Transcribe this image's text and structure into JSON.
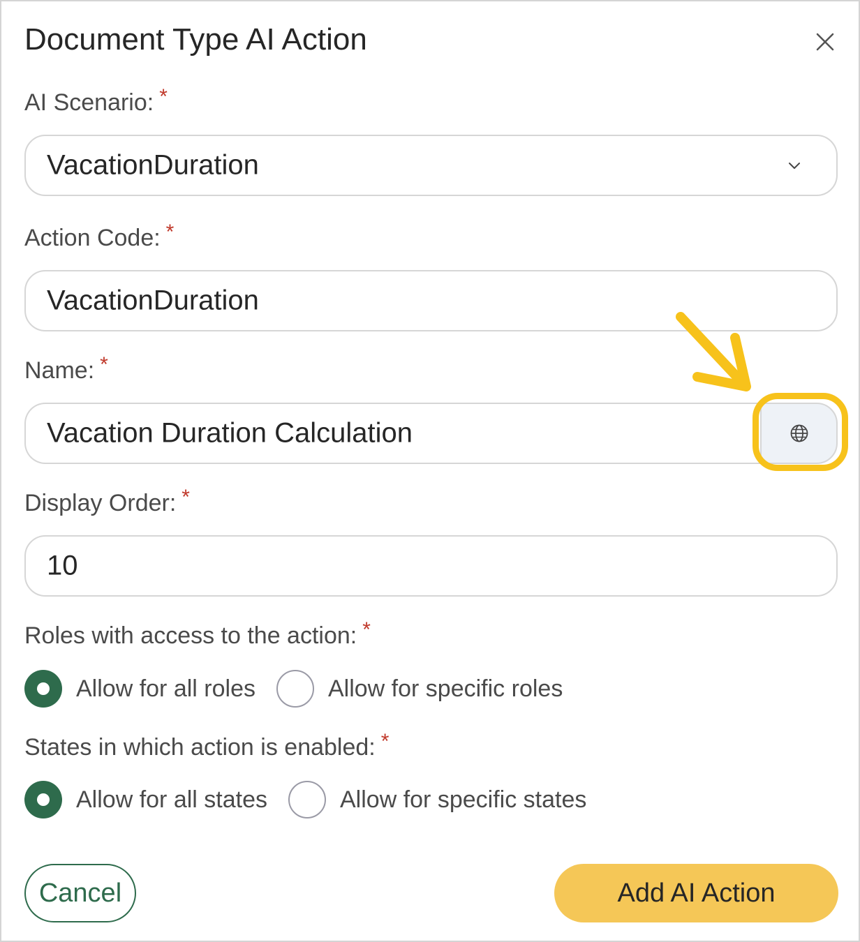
{
  "dialog": {
    "title": "Document Type AI Action"
  },
  "fields": {
    "ai_scenario": {
      "label": "AI Scenario:",
      "value": "VacationDuration",
      "required_mark": "*"
    },
    "action_code": {
      "label": "Action Code:",
      "value": "VacationDuration",
      "required_mark": "*"
    },
    "name": {
      "label": "Name:",
      "value": "Vacation Duration Calculation",
      "required_mark": "*"
    },
    "display_order": {
      "label": "Display Order:",
      "value": "10",
      "required_mark": "*"
    }
  },
  "roles": {
    "label": "Roles with access to the action:",
    "required_mark": "*",
    "options": [
      {
        "label": "Allow for all roles",
        "selected": true
      },
      {
        "label": "Allow for specific roles",
        "selected": false
      }
    ]
  },
  "states": {
    "label": "States in which action is enabled:",
    "required_mark": "*",
    "options": [
      {
        "label": "Allow for all states",
        "selected": true
      },
      {
        "label": "Allow for specific states",
        "selected": false
      }
    ]
  },
  "buttons": {
    "cancel": "Cancel",
    "add": "Add AI Action"
  },
  "icons": {
    "close": "close-icon",
    "chevron": "chevron-down-icon",
    "globe": "globe-icon",
    "annotation_arrow": "arrow-icon"
  },
  "colors": {
    "accent_green": "#2e6b4c",
    "primary_button": "#f5c757",
    "highlight": "#f7c21b",
    "required": "#c0392b"
  }
}
